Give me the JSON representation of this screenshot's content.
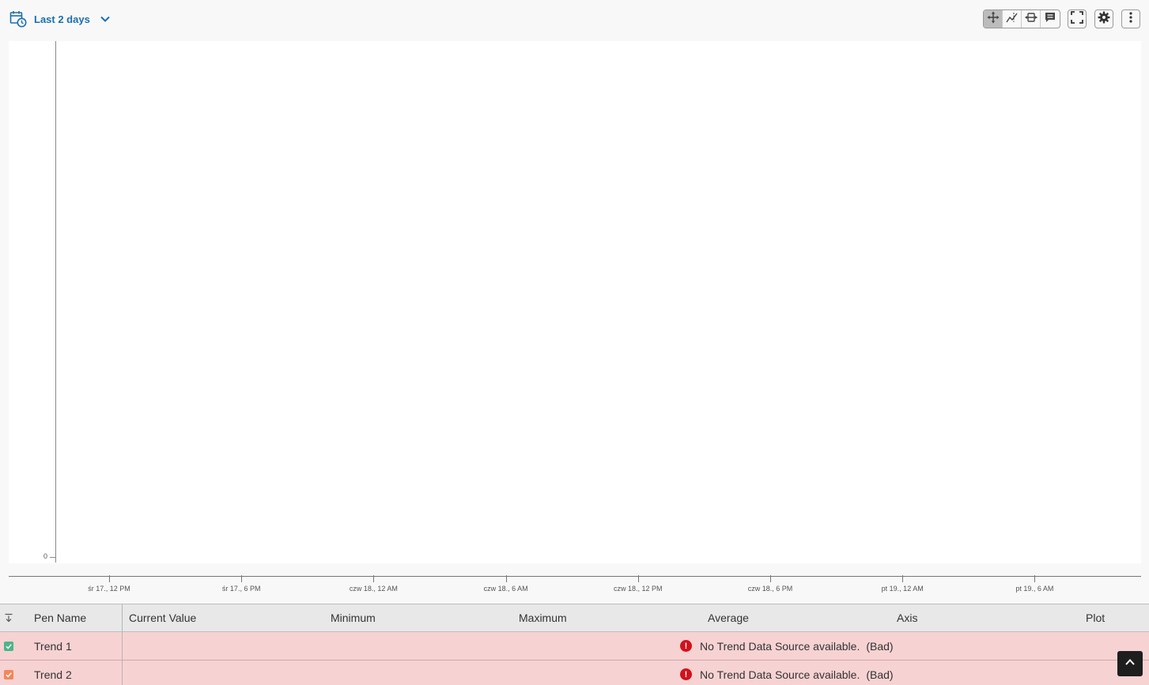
{
  "toolbar": {
    "range_label": "Last 2 days",
    "icons": [
      "calendar-clock-icon",
      "chevron-down-icon",
      "pan-icon",
      "zoom-selection-icon",
      "zoom-horizontal-icon",
      "annotation-icon",
      "fullscreen-icon",
      "settings-icon",
      "more-vertical-icon"
    ]
  },
  "colors": {
    "accent": "#1a6fb0",
    "error_row_bg": "#f7d2d3",
    "error_icon": "#d0121b",
    "trend1": "#4cb58a",
    "trend2": "#f2875a"
  },
  "chart_data": {
    "type": "line",
    "y_ticks": [
      "0"
    ],
    "x_ticks": [
      "śr 17., 12 PM",
      "śr 17., 6 PM",
      "czw 18., 12 AM",
      "czw 18., 6 AM",
      "czw 18., 12 PM",
      "czw 18., 6 PM",
      "pt 19., 12 AM",
      "pt 19., 6 AM"
    ],
    "series": []
  },
  "table": {
    "columns": {
      "pen_name": "Pen Name",
      "current_value": "Current Value",
      "minimum": "Minimum",
      "maximum": "Maximum",
      "average": "Average",
      "axis": "Axis",
      "plot": "Plot"
    },
    "rows": [
      {
        "name": "Trend 1",
        "checked": true,
        "color": "#4cb58a",
        "status": "No Trend Data Source available.",
        "quality": "(Bad)"
      },
      {
        "name": "Trend 2",
        "checked": true,
        "color": "#f2875a",
        "status": "No Trend Data Source available.",
        "quality": "(Bad)"
      }
    ]
  }
}
